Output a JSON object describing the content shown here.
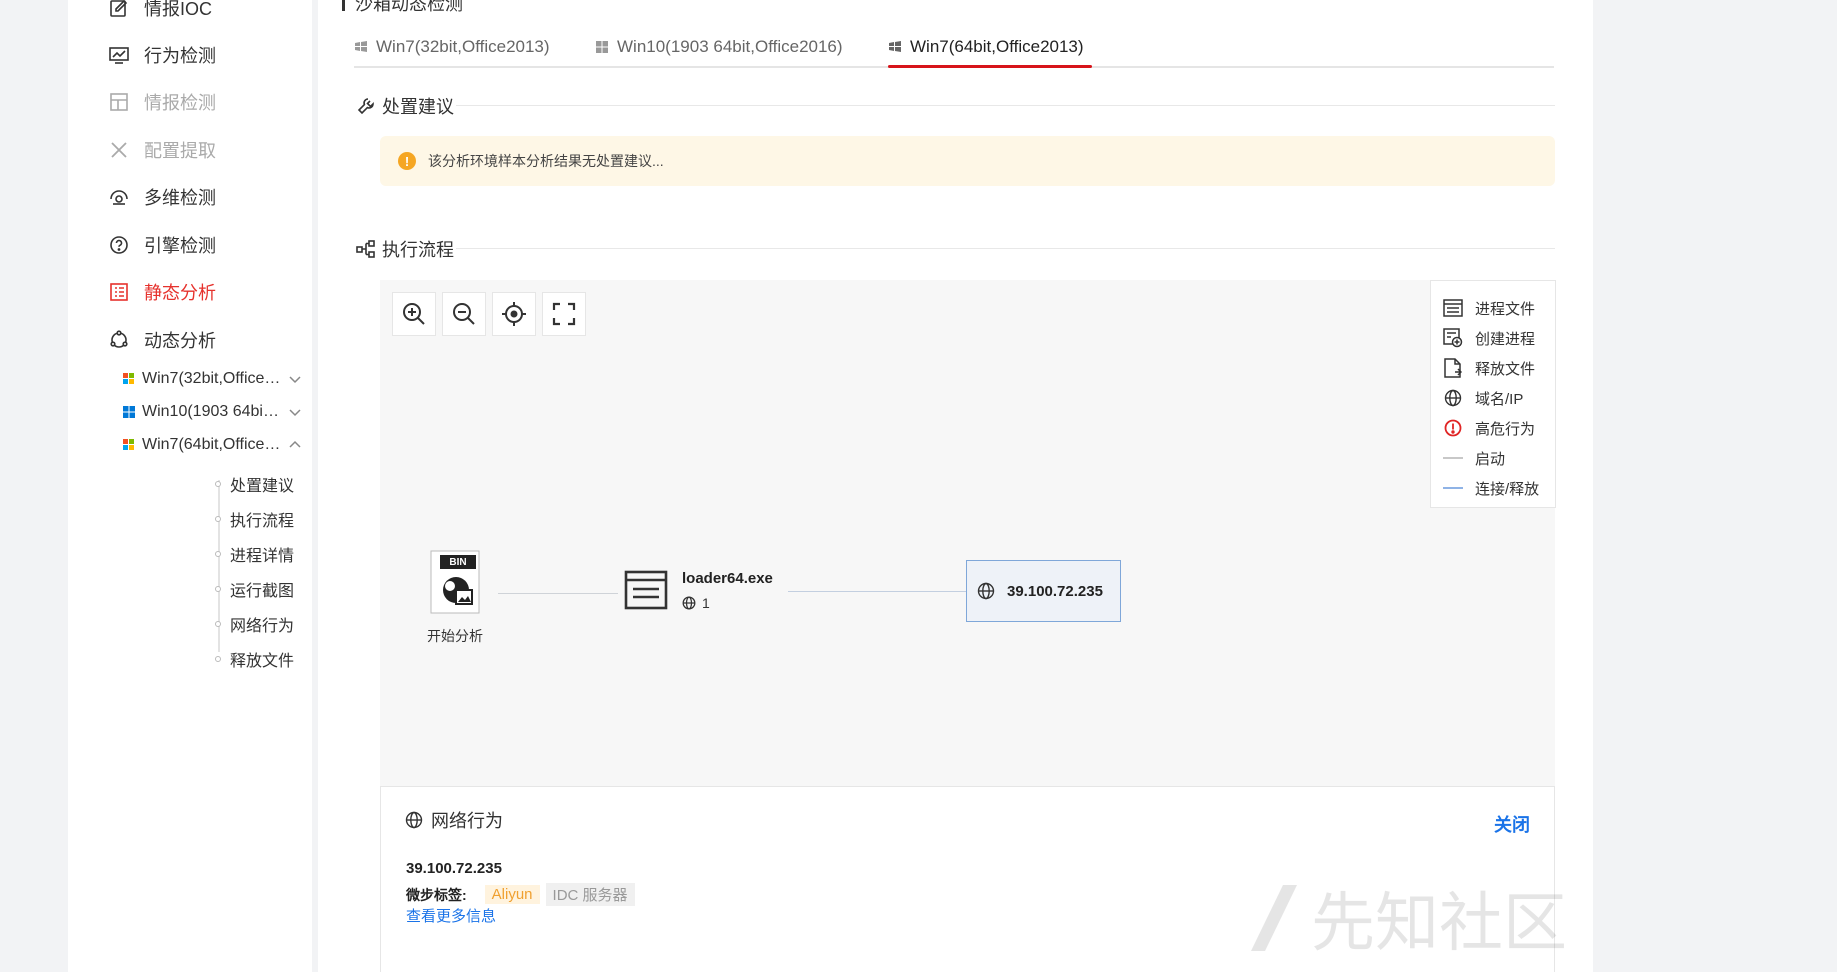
{
  "sidebar": {
    "items": [
      {
        "label": "情报IOC",
        "icon": "edit-doc-icon",
        "state": "normal"
      },
      {
        "label": "行为检测",
        "icon": "monitor-chart-icon",
        "state": "normal"
      },
      {
        "label": "情报检测",
        "icon": "layout-grid-icon",
        "state": "disabled"
      },
      {
        "label": "配置提取",
        "icon": "tools-icon",
        "state": "disabled"
      },
      {
        "label": "多维检测",
        "icon": "radar-icon",
        "state": "normal"
      },
      {
        "label": "引擎检测",
        "icon": "question-circle-icon",
        "state": "normal"
      },
      {
        "label": "静态分析",
        "icon": "list-doc-icon",
        "state": "active"
      },
      {
        "label": "动态分析",
        "icon": "cycle-icon",
        "state": "normal"
      }
    ],
    "envs": [
      {
        "label": "Win7(32bit,Office2013)",
        "icon": "windows7-icon",
        "expanded": false
      },
      {
        "label": "Win10(1903 64bit,Office2016)",
        "icon": "windows10-icon",
        "expanded": false
      },
      {
        "label": "Win7(64bit,Office2013)",
        "icon": "windows7-icon",
        "expanded": true
      }
    ],
    "sub_items": [
      "处置建议",
      "执行流程",
      "进程详情",
      "运行截图",
      "网络行为",
      "释放文件"
    ]
  },
  "main": {
    "top_heading": "沙箱动态检测",
    "tabs": [
      {
        "label": "Win7(32bit,Office2013)",
        "active": false
      },
      {
        "label": "Win10(1903 64bit,Office2016)",
        "active": false
      },
      {
        "label": "Win7(64bit,Office2013)",
        "active": true
      }
    ],
    "advice_title": "处置建议",
    "advice_text": "该分析环境样本分析结果无处置建议...",
    "flow_title": "执行流程"
  },
  "graph": {
    "start_label": "开始分析",
    "bin_badge": "BIN",
    "process_name": "loader64.exe",
    "process_net_count": "1",
    "ip_node": "39.100.72.235",
    "legend": [
      {
        "label": "进程文件",
        "icon": "process-file-icon"
      },
      {
        "label": "创建进程",
        "icon": "create-process-icon"
      },
      {
        "label": "释放文件",
        "icon": "release-file-icon"
      },
      {
        "label": "域名/IP",
        "icon": "globe-icon"
      },
      {
        "label": "高危行为",
        "icon": "alert-circle-icon"
      },
      {
        "label": "启动",
        "icon": "gray-line-icon"
      },
      {
        "label": "连接/释放",
        "icon": "blue-line-icon"
      }
    ]
  },
  "network_panel": {
    "title": "网络行为",
    "close_label": "关闭",
    "ip": "39.100.72.235",
    "tag_label": "微步标签:",
    "tags": [
      "Aliyun",
      "IDC 服务器"
    ],
    "more_link": "查看更多信息"
  },
  "watermark_text": "先知社区",
  "colors": {
    "accent_red": "#d7141a",
    "link_blue": "#1a73e8",
    "alert_bg": "#fef7e6"
  }
}
